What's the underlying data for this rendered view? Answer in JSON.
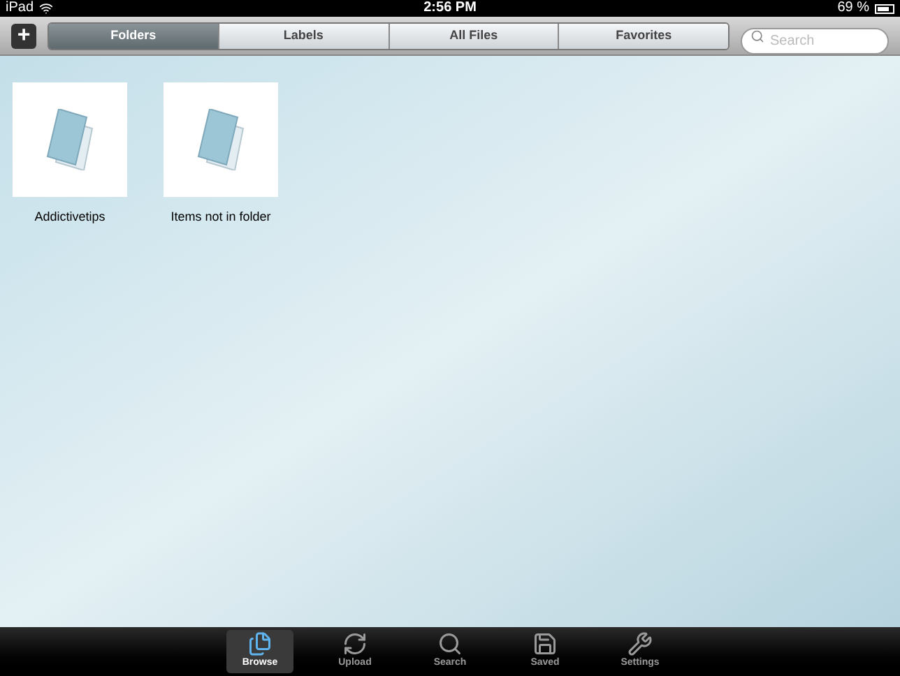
{
  "status_bar": {
    "device": "iPad",
    "time": "2:56 PM",
    "battery": "69 %"
  },
  "toolbar": {
    "add_button": "+",
    "segments": [
      {
        "label": "Folders",
        "selected": true
      },
      {
        "label": "Labels",
        "selected": false
      },
      {
        "label": "All Files",
        "selected": false
      },
      {
        "label": "Favorites",
        "selected": false
      }
    ],
    "search": {
      "placeholder": "Search"
    }
  },
  "folders": [
    {
      "name": "Addictivetips"
    },
    {
      "name": "Items not in folder"
    }
  ],
  "tab_bar": [
    {
      "label": "Browse",
      "kind": "browse",
      "selected": true
    },
    {
      "label": "Upload",
      "kind": "upload",
      "selected": false
    },
    {
      "label": "Search",
      "kind": "search",
      "selected": false
    },
    {
      "label": "Saved",
      "kind": "saved",
      "selected": false
    },
    {
      "label": "Settings",
      "kind": "settings",
      "selected": false
    }
  ]
}
